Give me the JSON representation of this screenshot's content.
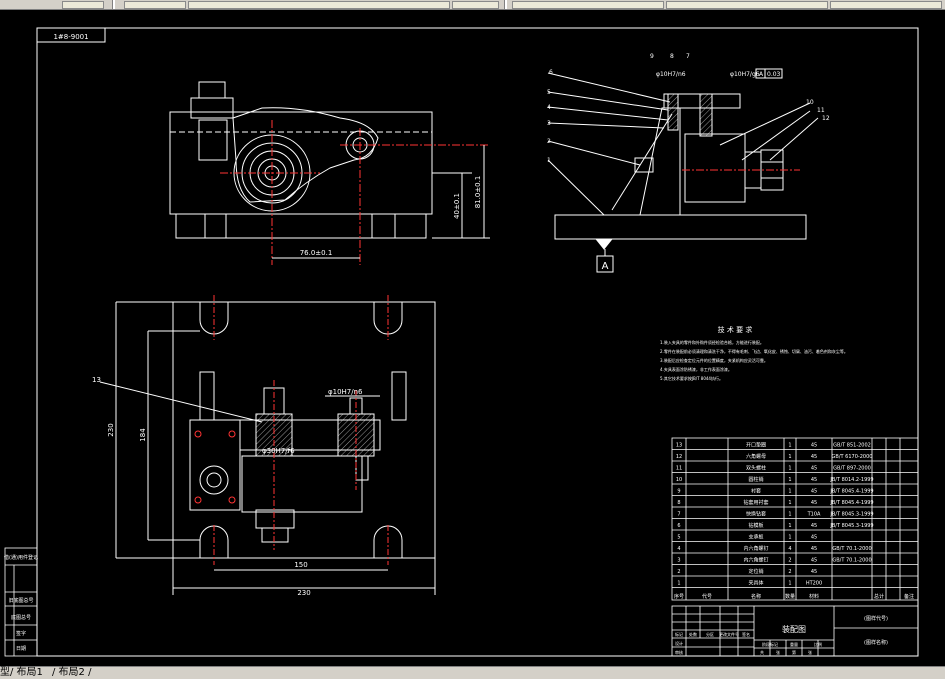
{
  "window": {
    "title": "AutoCAD drawing - fixture assembly"
  },
  "tabs": [
    {
      "label": "型"
    },
    {
      "label": "/ 布局1"
    },
    {
      "label": "/ 布局2 /"
    }
  ],
  "drawing": {
    "corner_label": "1#8-9001",
    "datum_label": "A",
    "side_view": {
      "part_numbers_left": [
        "6",
        "5",
        "4",
        "3",
        "2",
        "1"
      ],
      "part_numbers_right": [
        "10",
        "11",
        "12"
      ],
      "part_numbers_top": [
        "9",
        "8",
        "7"
      ],
      "tol_1": "φ10H7/n6",
      "tol_2": "φ10H7/g6",
      "geo_tol": "0.03",
      "geo_tol_datum": "A"
    },
    "front_view": {
      "dim_horizontal": "76.0±0.1",
      "dim_v1": "40±0.1",
      "dim_v2": "81.0±0.1"
    },
    "top_view": {
      "leader_label": "13",
      "fit_label": "φ30H7/f6",
      "fit_label_2": "φ10H7/n6",
      "dim_150": "150",
      "dim_230": "230",
      "dim_vert_230": "230",
      "dim_vert_184": "184"
    },
    "tech_requirements": {
      "title": "技 术 要 求",
      "lines": [
        "1.装入夹具的零件和外购件须经检验合格，方能进行装配。",
        "2.零件在装配前必须清理和清洗干净，不得有毛刺、飞边、氧化皮、锈蚀、切屑、油污、着色剂和灰尘等。",
        "3.装配后应检查定位元件的位置精度，夹紧机构应灵活可靠。",
        "4.夹具表面涂防锈漆，非工作表面涂漆。",
        "5.其它技术要求按JB/T 8044执行。"
      ]
    },
    "bom": {
      "rows": [
        {
          "no": "13",
          "name": "开口垫圈",
          "qty": "1",
          "mat": "45",
          "std": "GB/T 851-2002"
        },
        {
          "no": "12",
          "name": "六角螺母",
          "qty": "1",
          "mat": "45",
          "std": "GB/T 6170-2000"
        },
        {
          "no": "11",
          "name": "双头螺柱",
          "qty": "1",
          "mat": "45",
          "std": "GB/T 897-2000"
        },
        {
          "no": "10",
          "name": "圆柱销",
          "qty": "1",
          "mat": "45",
          "std": "JB/T 8014.2-1999"
        },
        {
          "no": "9",
          "name": "衬套",
          "qty": "1",
          "mat": "45",
          "std": "JB/T 8045.4-1999"
        },
        {
          "no": "8",
          "name": "钻套用衬套",
          "qty": "1",
          "mat": "45",
          "std": "JB/T 8045.4-1999"
        },
        {
          "no": "7",
          "name": "快换钻套",
          "qty": "1",
          "mat": "T10A",
          "std": "JB/T 8045.3-1999"
        },
        {
          "no": "6",
          "name": "钻模板",
          "qty": "1",
          "mat": "45",
          "std": "JB/T 8045.3-1999"
        },
        {
          "no": "5",
          "name": "支承板",
          "qty": "1",
          "mat": "45",
          "std": ""
        },
        {
          "no": "4",
          "name": "内六角螺钉",
          "qty": "4",
          "mat": "45",
          "std": "GB/T 70.1-2000"
        },
        {
          "no": "3",
          "name": "内六角螺钉",
          "qty": "2",
          "mat": "45",
          "std": "GB/T 70.1-2000"
        },
        {
          "no": "2",
          "name": "定位销",
          "qty": "2",
          "mat": "45",
          "std": ""
        },
        {
          "no": "1",
          "name": "夹具体",
          "qty": "1",
          "mat": "HT200",
          "std": ""
        }
      ],
      "header": {
        "no": "序号",
        "code": "代号",
        "name": "名称",
        "qty": "数量",
        "mat": "材料",
        "unit_wt": "单件",
        "total_wt": "总计",
        "note": "备注"
      }
    },
    "title_block": {
      "drawing_title": "装配图",
      "school": "(图样代号)",
      "part_name": "(图样名称)",
      "labels": [
        "标记",
        "处数",
        "分区",
        "更改文件号",
        "签名",
        "年月日",
        "设计",
        "审核",
        "工艺",
        "批准"
      ],
      "stage_labels": [
        "阶段标记",
        "重量",
        "比例"
      ],
      "sheet_labels": [
        "共",
        "张",
        "第",
        "张"
      ]
    },
    "left_strip": [
      "借(通)用件登记",
      "旧底图总号",
      "底图总号",
      "签字",
      "日期"
    ]
  },
  "colors": {
    "line": "#ffffff",
    "magenta": "#ff00ff",
    "red": "#ff3333",
    "yellow": "#ffff00",
    "background": "#000000"
  }
}
